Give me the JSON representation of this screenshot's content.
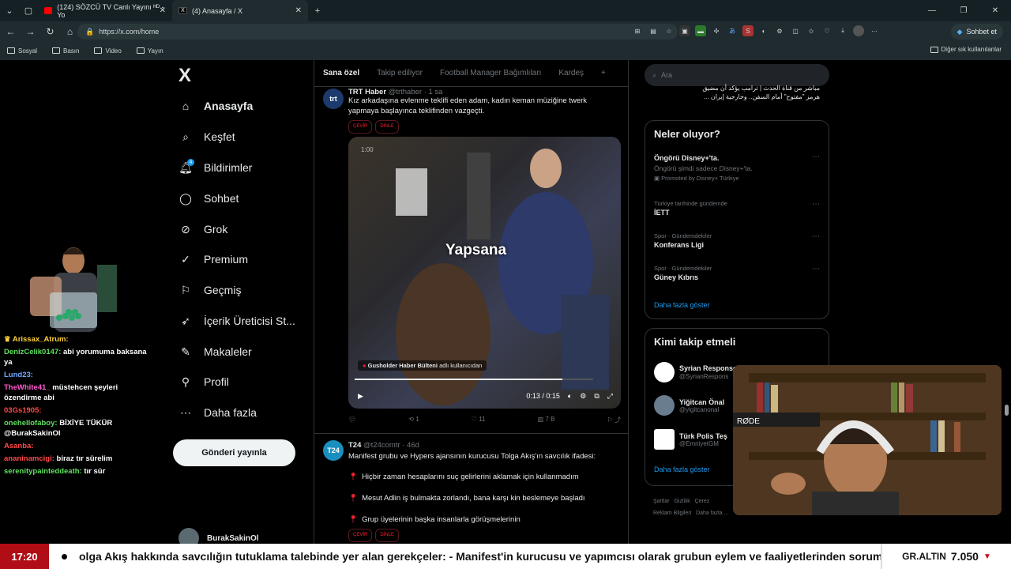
{
  "browser": {
    "tabs": [
      {
        "title": "(124) SÖZCÜ TV Canlı Yayını ᴴᴰ - Yo",
        "favicon_color": "#ff0000"
      },
      {
        "title": "(4) Anasayfa / X",
        "favicon_color": "#000000"
      }
    ],
    "url": "https://x.com/home",
    "profile_label": "Sohbet et",
    "bookmarks": [
      "Sosyal",
      "Basın",
      "Video",
      "Yayın"
    ],
    "other_bookmarks": "Diğer sık kullanılanlar"
  },
  "sidebar": {
    "logo": "X",
    "items": [
      {
        "label": "Anasayfa",
        "icon": "home-icon"
      },
      {
        "label": "Keşfet",
        "icon": "search-icon"
      },
      {
        "label": "Bildirimler",
        "icon": "bell-icon",
        "badge": "4"
      },
      {
        "label": "Sohbet",
        "icon": "chat-icon"
      },
      {
        "label": "Grok",
        "icon": "grok-icon"
      },
      {
        "label": "Premium",
        "icon": "premium-icon"
      },
      {
        "label": "Geçmiş",
        "icon": "bookmark-icon"
      },
      {
        "label": "İçerik Üreticisi St...",
        "icon": "rocket-icon"
      },
      {
        "label": "Makaleler",
        "icon": "article-icon"
      },
      {
        "label": "Profil",
        "icon": "profile-icon"
      },
      {
        "label": "Daha fazla",
        "icon": "more-icon"
      }
    ],
    "post_button": "Gönderi yayınla",
    "account_name": "BurakSakinOl"
  },
  "feed": {
    "tabs": [
      "Sana özel",
      "Takip ediliyor",
      "Football Manager Bağımlıları",
      "Kardeş"
    ],
    "tweet1": {
      "author": "TRT Haber",
      "handle": "@trthaber · 1 sa",
      "text": "Kız arkadaşına evlenme teklifi eden adam, kadın keman müziğine twerk yapmaya başlayınca teklifinden vazgeçti.",
      "chips": [
        "ÇEVİR",
        "DİNLE"
      ],
      "video": {
        "counter": "1:00",
        "overlay": "Yapsana",
        "credit_user": "Gusholder Haber Bülteni",
        "credit_suffix": "adlı kullanıcıdan",
        "time": "0:13 / 0:15",
        "progress": 0.87
      },
      "stats": {
        "replies": "",
        "reposts": "1",
        "likes": "11",
        "views": "7 B"
      }
    },
    "tweet2": {
      "author": "T24",
      "handle": "@t24comtr · 46d",
      "text": "Manifest grubu ve Hypers ajansının kurucusu Tolga Akış'ın savcılık ifadesi:",
      "bullets": [
        "Hiçbir zaman hesaplarını suç gelirlerini aklamak için kullanmadım",
        "Mesut Adlin iş bulmakta zorlandı, bana karşı kin beslemeye başladı",
        "Grup üyelerinin başka insanlarla görüşmelerinin"
      ],
      "chips": [
        "ÇEVİR",
        "DİNLE"
      ]
    }
  },
  "right": {
    "search_placeholder": "Ara",
    "arabic_line1": "مباشر من قناة الحدث | ترامب يؤكد أن مضيق",
    "arabic_line2": "هرمز \"مفتوح\" أمام السفن.. وخارجية إيران ...",
    "trends_title": "Neler oluyor?",
    "trends": [
      {
        "meta": "",
        "name": "Öngörü Disney+'ta.",
        "sub": "Öngörü şimdi sadece Disney+'ta.",
        "promo": "Promoted by Disney+ Türkiye"
      },
      {
        "meta": "Türkiye tarihinde gündemde",
        "name": "İETT"
      },
      {
        "meta": "Spor · Gündemdekiler",
        "name": "Konferans Ligi"
      },
      {
        "meta": "Spor · Gündemdekiler",
        "name": "Güney Kıbrıs"
      }
    ],
    "show_more": "Daha fazla göster",
    "follow_title": "Kimi takip etmeli",
    "follows": [
      {
        "name": "Syrian Response",
        "handle": "@SyrianRespons"
      },
      {
        "name": "Yiğitcan Önal",
        "handle": "@yigitcanonal"
      },
      {
        "name": "Türk Polis Teş",
        "handle": "@EmniyetGM"
      }
    ],
    "follow_show_more": "Daha fazla göster",
    "footer": [
      "Şartlar",
      "Gizlilik",
      "Çerez",
      "Reklam Bilgileri",
      "Daha fazla ..."
    ]
  },
  "chat": [
    {
      "user": "Arissax_Atrum:",
      "msg": "",
      "color": "#ffd23c"
    },
    {
      "user": "DenizCelik0147:",
      "msg": "abi yorumuma baksana ya",
      "color": "#5ee05e"
    },
    {
      "user": "Lund23:",
      "msg": "",
      "color": "#6fa8ff"
    },
    {
      "user": "TheWhite41_",
      "msg": "müstehcen şeyleri özendirme abi",
      "color": "#ff5ad1"
    },
    {
      "user": "03Gs1905:",
      "msg": "",
      "color": "#ff4a4a"
    },
    {
      "user": "onehellofaboy:",
      "msg": "BİXİYE TÜKÜR @BurakSakinOl",
      "color": "#5ee05e"
    },
    {
      "user": "Asanba:",
      "msg": "",
      "color": "#ff4a4a"
    },
    {
      "user": "ananinamcigi:",
      "msg": "biraz tır sürelim",
      "color": "#ff4a4a"
    },
    {
      "user": "serenitypainteddeath:",
      "msg": "tır sür",
      "color": "#5ee05e"
    }
  ],
  "ticker": {
    "time": "17:20",
    "text": "olga Akış hakkında savcılığın tutuklama talebinde yer alan gerekçeler: - Manifest'in kurucusu ve yapımcısı olarak grubun eylem ve faaliyetlerinden sorumlu ol",
    "gold_label": "GR.ALTIN",
    "gold_value": "7.050",
    "gold_trend": "▼"
  }
}
